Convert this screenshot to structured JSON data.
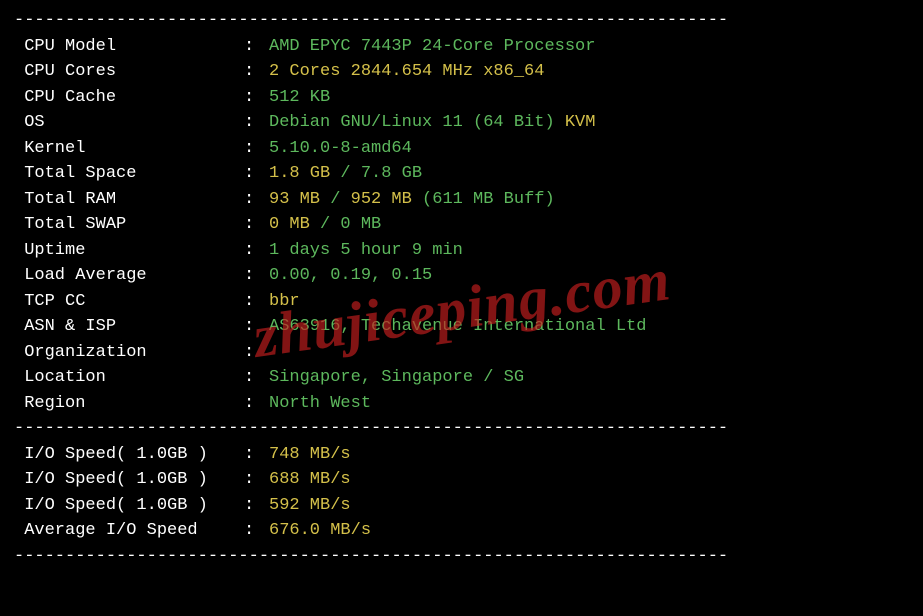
{
  "divider": "----------------------------------------------------------------------",
  "system": {
    "cpu_model_label": " CPU Model          ",
    "cpu_model_value": "AMD EPYC 7443P 24-Core Processor",
    "cpu_cores_label": " CPU Cores          ",
    "cpu_cores_value": "2 Cores 2844.654 MHz x86_64",
    "cpu_cache_label": " CPU Cache          ",
    "cpu_cache_value": "512 KB",
    "os_label": " OS                 ",
    "os_value": "Debian GNU/Linux 11 (64 Bit) ",
    "os_virt": "KVM",
    "kernel_label": " Kernel             ",
    "kernel_value": "5.10.0-8-amd64",
    "total_space_label": " Total Space        ",
    "total_space_used": "1.8 GB ",
    "total_space_sep": "/ ",
    "total_space_total": "7.8 GB",
    "total_ram_label": " Total RAM          ",
    "total_ram_used": "93 MB ",
    "total_ram_sep": "/ ",
    "total_ram_total": "952 MB ",
    "total_ram_buff": "(611 MB Buff)",
    "total_swap_label": " Total SWAP         ",
    "total_swap_used": "0 MB ",
    "total_swap_sep": "/ ",
    "total_swap_total": "0 MB",
    "uptime_label": " Uptime             ",
    "uptime_value": "1 days 5 hour 9 min",
    "load_label": " Load Average       ",
    "load_value": "0.00, 0.19, 0.15",
    "tcp_label": " TCP CC             ",
    "tcp_value": "bbr",
    "asn_label": " ASN & ISP          ",
    "asn_value": "AS63916, Techavenue International Ltd",
    "org_label": " Organization       ",
    "org_value": "",
    "location_label": " Location           ",
    "location_value": "Singapore, Singapore / SG",
    "region_label": " Region             ",
    "region_value": "North West"
  },
  "io": {
    "speed1_label": " I/O Speed( 1.0GB ) ",
    "speed1_value": "748 MB/s",
    "speed2_label": " I/O Speed( 1.0GB ) ",
    "speed2_value": "688 MB/s",
    "speed3_label": " I/O Speed( 1.0GB ) ",
    "speed3_value": "592 MB/s",
    "avg_label": " Average I/O Speed  ",
    "avg_value": "676.0 MB/s"
  },
  "watermark": "zhujiceping.com"
}
